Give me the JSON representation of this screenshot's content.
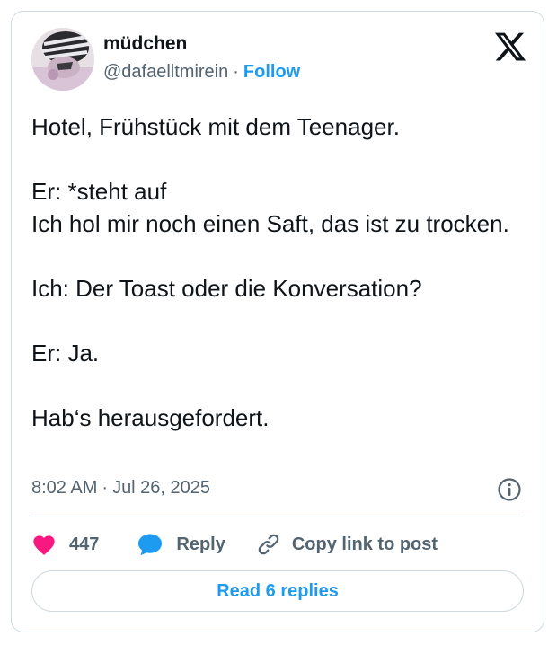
{
  "author": {
    "display_name": "müdchen",
    "handle": "@dafaelltmirein",
    "separator": "·",
    "follow_label": "Follow"
  },
  "tweet": {
    "paragraphs": [
      "Hotel, Frühstück mit dem Teenager.",
      "Er: *steht auf",
      "Ich hol mir noch einen Saft, das ist zu trocken.",
      "Ich: Der Toast oder die Konversation?",
      "Er: Ja.",
      "Hab‘s herausgefordert."
    ],
    "time": "8:02 AM",
    "separator": "·",
    "date": "Jul 26, 2025"
  },
  "actions": {
    "like_count": "447",
    "reply_label": "Reply",
    "copy_label": "Copy link to post"
  },
  "read_replies_label": "Read 6 replies",
  "colors": {
    "accent": "#1d9bf0",
    "like": "#f91880",
    "text": "#0f1419",
    "muted": "#536471",
    "border": "#cfd9de"
  },
  "icons": {
    "logo": "x-logo-icon",
    "info": "info-icon",
    "like": "heart-icon",
    "reply": "speech-bubble-icon",
    "copy": "link-icon"
  }
}
